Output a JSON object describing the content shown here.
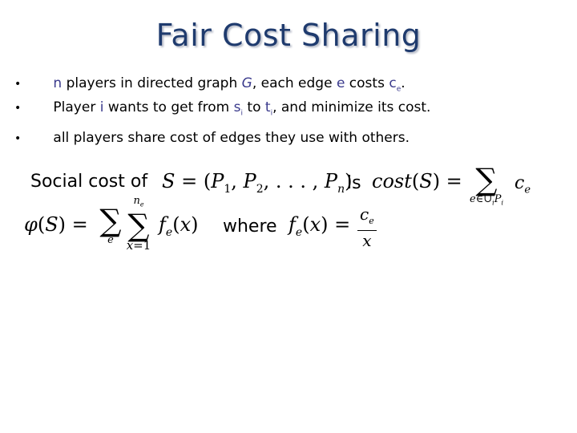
{
  "slide": {
    "title": "Fair Cost Sharing",
    "bullets": [
      {
        "marker": "•",
        "parts": [
          "n",
          " players in directed graph ",
          "G",
          ", each edge ",
          "e",
          " costs ",
          "c",
          "e",
          "."
        ]
      },
      {
        "marker": "•",
        "parts": [
          "Player ",
          "i",
          " wants to get from ",
          "s",
          "i",
          " to ",
          "t",
          "i",
          ", and minimize its cost."
        ]
      },
      {
        "marker": "•",
        "text": "all players share cost of edges they use with others."
      }
    ],
    "social_cost": {
      "lead": "Social cost of",
      "strategy_formula": "S = (P1, P2, ..., Pn)",
      "is_word": "is",
      "cost_formula": "cost(S) = Σ_{e∈∪i Pi} c_e"
    },
    "potential": {
      "formula": "φ(S) = Σ_e Σ_{x=1}^{n_e} f_e(x)",
      "where_word": "where",
      "f_formula": "f_e(x) = c_e / x"
    },
    "colors": {
      "title": "#1f3b6e",
      "highlight": "#3a3a8c",
      "text": "#000000"
    }
  }
}
